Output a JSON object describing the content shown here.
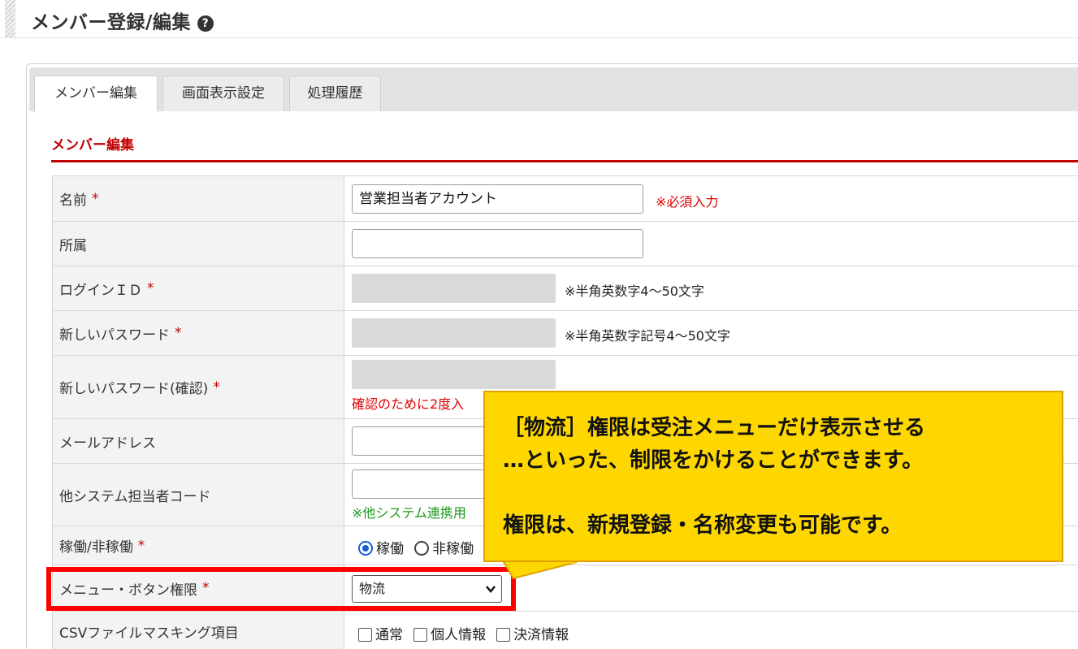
{
  "header": {
    "title": "メンバー登録/編集",
    "help_icon": "?"
  },
  "tabs": [
    {
      "label": "メンバー編集",
      "active": true
    },
    {
      "label": "画面表示設定",
      "active": false
    },
    {
      "label": "処理履歴",
      "active": false
    }
  ],
  "section": {
    "title": "メンバー編集"
  },
  "form": {
    "name": {
      "label": "名前",
      "required": "*",
      "value": "営業担当者アカウント",
      "note": "※必須入力"
    },
    "affiliation": {
      "label": "所属",
      "value": ""
    },
    "login_id": {
      "label": "ログインＩＤ",
      "required": "*",
      "note": "※半角英数字4～50文字"
    },
    "new_password": {
      "label": "新しいパスワード",
      "required": "*",
      "note": "※半角英数字記号4～50文字"
    },
    "new_password_confirm": {
      "label": "新しいパスワード(確認)",
      "required": "*",
      "note": "確認のために2度入"
    },
    "email": {
      "label": "メールアドレス",
      "value": ""
    },
    "other_system_code": {
      "label": "他システム担当者コード",
      "value": "",
      "note": "※他システム連携用"
    },
    "status": {
      "label": "稼働/非稼働",
      "required": "*",
      "options": [
        "稼働",
        "非稼働"
      ],
      "selected": "稼働"
    },
    "permission": {
      "label": "メニュー・ボタン権限",
      "required": "*",
      "selected": "物流"
    },
    "csv_masking": {
      "label": "CSVファイルマスキング項目",
      "options": [
        "通常",
        "個人情報",
        "決済情報"
      ]
    }
  },
  "callout": {
    "line1": "［物流］権限は受注メニューだけ表示させる",
    "line2": "…といった、制限をかけることができます。",
    "line3": "権限は、新規登録・名称変更も可能です。"
  },
  "colors": {
    "accent": "#c00000",
    "highlight": "#ff0000",
    "callout_bg": "#ffd700"
  }
}
